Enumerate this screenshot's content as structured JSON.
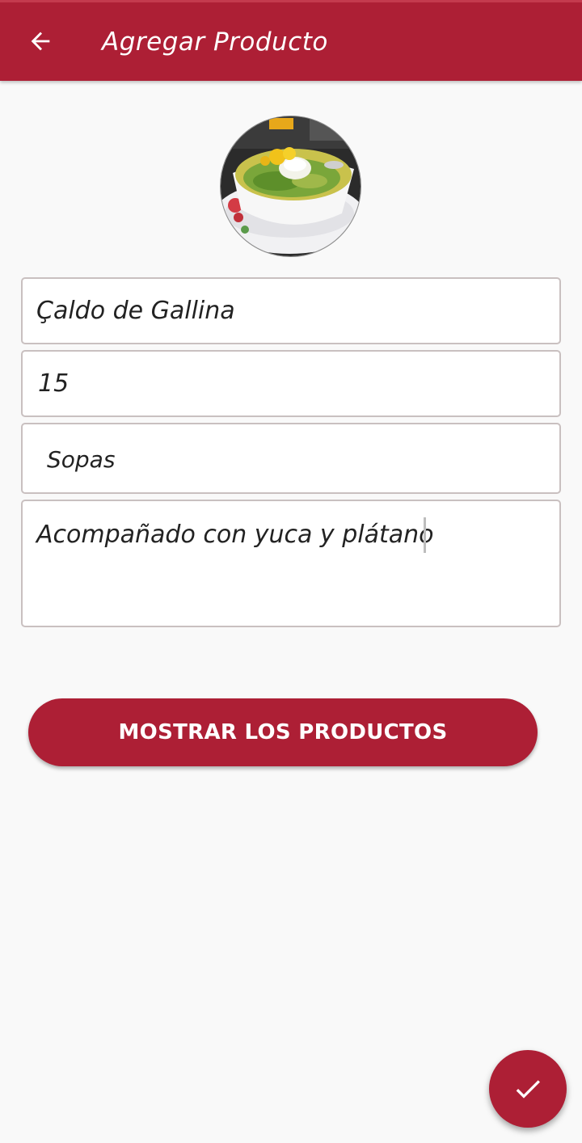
{
  "app_bar": {
    "title": "Agregar Producto",
    "back_icon": "arrow-back-icon",
    "color": "#ad1f35"
  },
  "product_image": {
    "icon": "soup-bowl-photo"
  },
  "form": {
    "name_value": "Çaldo de Gallina",
    "price_value": "15",
    "category_value": "Sopas",
    "description_value": "Acompañado con yuca y plátano"
  },
  "buttons": {
    "show_products_label": "MOSTRAR LOS PRODUCTOS",
    "fab_icon": "check-icon"
  },
  "colors": {
    "accent": "#ad1f35",
    "background": "#f9f9f9"
  }
}
